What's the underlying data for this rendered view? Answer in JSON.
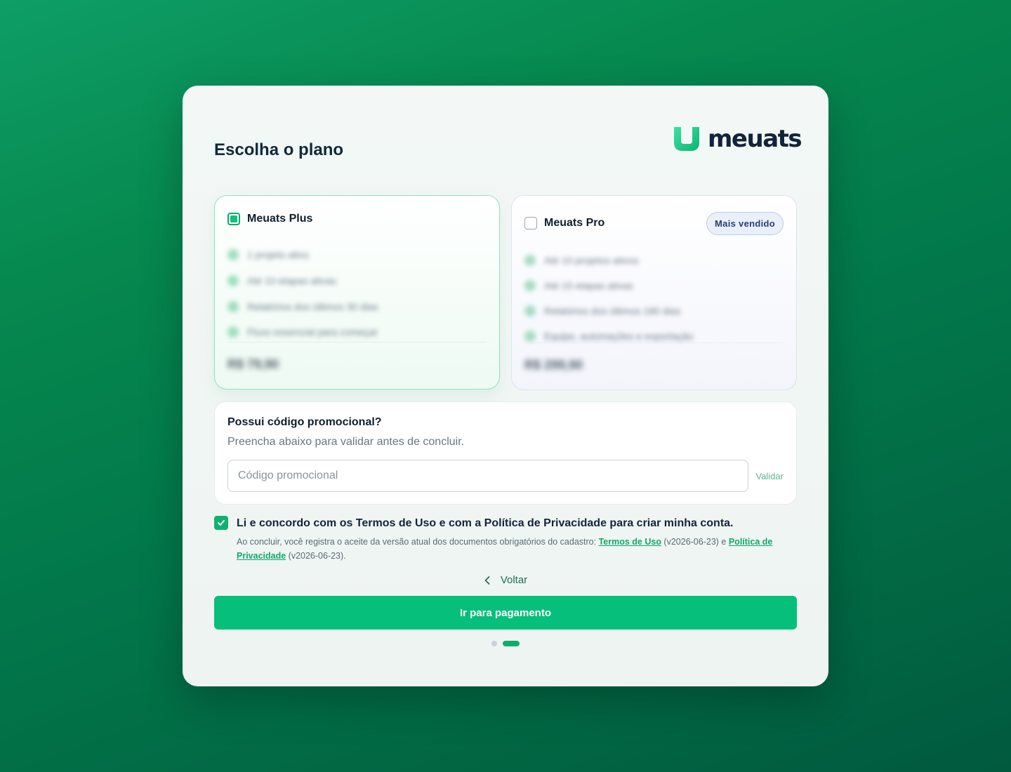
{
  "header": {
    "title": "Escolha o plano",
    "logo_text": "meuats"
  },
  "plans": [
    {
      "name": "Meuats Plus",
      "selected": true,
      "features": [
        "1 projeto ativo",
        "Até 10 etapas ativas",
        "Relatórios dos últimos 30 dias",
        "Fluxo essencial para começar"
      ],
      "price": "R$ 79,90"
    },
    {
      "name": "Meuats Pro",
      "selected": false,
      "badge": "Mais vendido",
      "features": [
        "Até 10 projetos ativos",
        "Até 15 etapas ativas",
        "Relatórios dos últimos 180 dias",
        "Equipe, automações e exportação"
      ],
      "price": "R$ 299,90"
    }
  ],
  "promo": {
    "title": "Possui código promocional?",
    "subtitle": "Preencha abaixo para validar antes de concluir.",
    "placeholder": "Código promocional",
    "value": "",
    "validate_label": "Validar"
  },
  "agreement": {
    "checked": true,
    "main_text": "Li e concordo com os Termos de Uso e com a Política de Privacidade para criar minha conta.",
    "detail_prefix": "Ao concluir, você registra o aceite da versão atual dos documentos obrigatórios do cadastro: ",
    "terms_link": "Termos de Uso",
    "terms_version": " (v2026-06-23) e ",
    "privacy_link": "Política de Privacidade",
    "privacy_version": " (v2026-06-23)."
  },
  "nav": {
    "back_label": "Voltar",
    "submit_label": "Ir para pagamento",
    "steps_total": 2,
    "current_step": 2
  },
  "colors": {
    "accent": "#06bf7b",
    "background": "#02774a",
    "badge_text": "#2a3d73"
  }
}
